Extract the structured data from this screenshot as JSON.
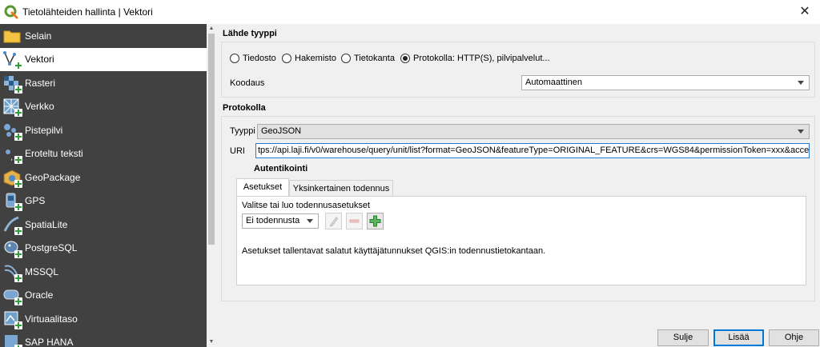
{
  "window": {
    "title": "Tietolähteiden hallinta | Vektori"
  },
  "sidebar": {
    "items": [
      {
        "label": "Selain",
        "icon": "folder-icon"
      },
      {
        "label": "Vektori",
        "icon": "vector-layer-icon",
        "active": true
      },
      {
        "label": "Rasteri",
        "icon": "raster-layer-icon"
      },
      {
        "label": "Verkko",
        "icon": "mesh-layer-icon"
      },
      {
        "label": "Pistepilvi",
        "icon": "point-cloud-icon"
      },
      {
        "label": "Eroteltu teksti",
        "icon": "delimited-text-icon"
      },
      {
        "label": "GeoPackage",
        "icon": "geopackage-icon"
      },
      {
        "label": "GPS",
        "icon": "gps-icon"
      },
      {
        "label": "SpatiaLite",
        "icon": "spatialite-icon"
      },
      {
        "label": "PostgreSQL",
        "icon": "postgresql-icon"
      },
      {
        "label": "MSSQL",
        "icon": "mssql-icon"
      },
      {
        "label": "Oracle",
        "icon": "oracle-icon"
      },
      {
        "label": "Virtuaalitaso",
        "icon": "virtual-layer-icon"
      },
      {
        "label": "SAP HANA",
        "icon": "sap-hana-icon"
      }
    ]
  },
  "source_type": {
    "title": "Lähde tyyppi",
    "options": [
      {
        "label": "Tiedosto",
        "checked": false
      },
      {
        "label": "Hakemisto",
        "checked": false
      },
      {
        "label": "Tietokanta",
        "checked": false
      },
      {
        "label": "Protokolla: HTTP(S), pilvipalvelut...",
        "checked": true
      }
    ],
    "encoding_label": "Koodaus",
    "encoding_value": "Automaattinen"
  },
  "protocol": {
    "title": "Protokolla",
    "type_label": "Tyyppi",
    "type_value": "GeoJSON",
    "uri_label": "URI",
    "uri_value": "tps://api.laji.fi/v0/warehouse/query/unit/list?format=GeoJSON&featureType=ORIGINAL_FEATURE&crs=WGS84&permissionToken=xxx&access_token=xxx"
  },
  "authentication": {
    "title": "Autentikointi",
    "tabs": [
      {
        "label": "Asetukset",
        "active": true
      },
      {
        "label": "Yksinkertainen todennus",
        "active": false
      }
    ],
    "select_label": "Valitse tai luo todennusasetukset",
    "config_value": "Ei todennusta",
    "info_text": "Asetukset tallentavat salatut käyttäjätunnukset QGIS:in todennustietokantaan."
  },
  "buttons": {
    "close": "Sulje",
    "add": "Lisää",
    "help": "Ohje"
  },
  "colors": {
    "sidebar_bg": "#414141",
    "accent": "#0078d7",
    "qgis_green": "#589632"
  }
}
